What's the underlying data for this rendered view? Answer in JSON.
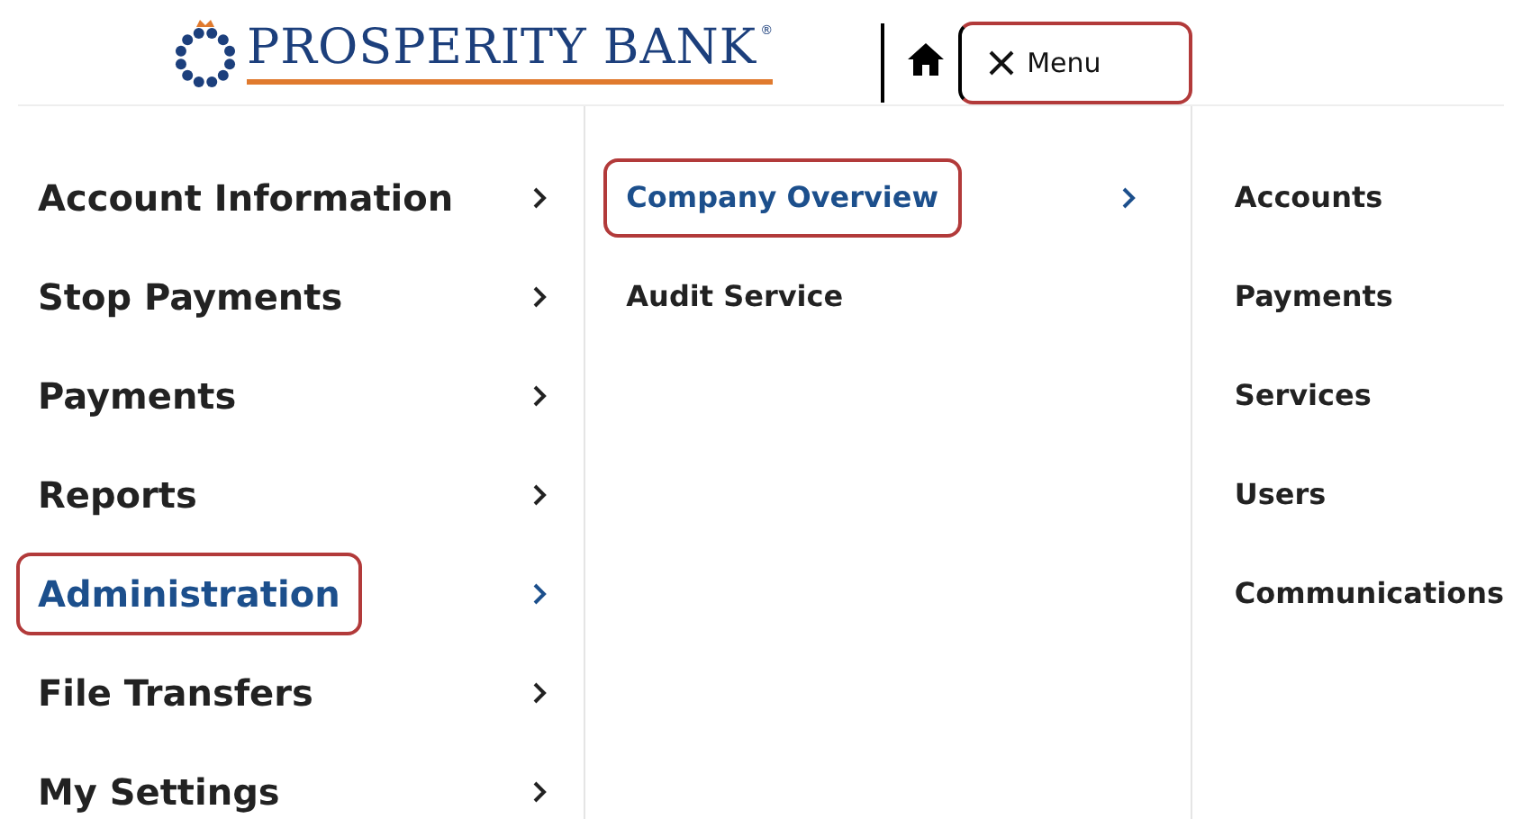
{
  "header": {
    "logo_text": "PROSPERITY BANK",
    "logo_mark": "®",
    "menu_button": {
      "label": "Menu",
      "outlined": true
    }
  },
  "menu_level_1": [
    {
      "label": "Account Information",
      "selected": false
    },
    {
      "label": "Stop Payments",
      "selected": false
    },
    {
      "label": "Payments",
      "selected": false
    },
    {
      "label": "Reports",
      "selected": false
    },
    {
      "label": "Administration",
      "selected": true
    },
    {
      "label": "File Transfers",
      "selected": false
    },
    {
      "label": "My Settings",
      "selected": false
    }
  ],
  "menu_level_2": [
    {
      "label": "Company Overview",
      "selected": true,
      "has_children": true
    },
    {
      "label": "Audit Service",
      "selected": false,
      "has_children": false
    }
  ],
  "menu_level_3": [
    {
      "label": "Accounts"
    },
    {
      "label": "Payments"
    },
    {
      "label": "Services"
    },
    {
      "label": "Users"
    },
    {
      "label": "Communications"
    }
  ]
}
